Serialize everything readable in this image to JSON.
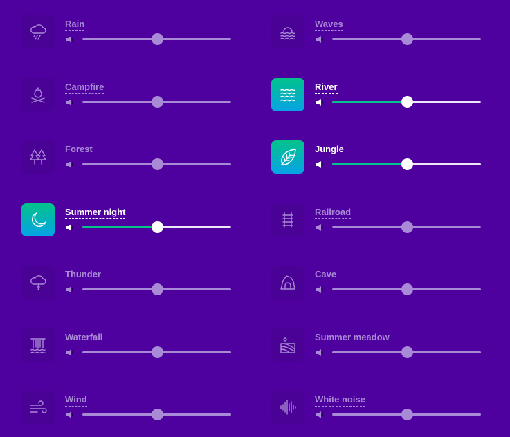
{
  "colors": {
    "background": "#4f019f",
    "inactive": "#a98ad6",
    "active_fill": "#01c38a",
    "gradient_top": "#01c38a",
    "gradient_bottom": "#06a3e6"
  },
  "sounds": [
    {
      "label": "Rain",
      "icon": "cloud-rain-icon",
      "active": false,
      "volume": 0.5,
      "underline": true
    },
    {
      "label": "Waves",
      "icon": "waves-sun-icon",
      "active": false,
      "volume": 0.5,
      "underline": true
    },
    {
      "label": "Campfire",
      "icon": "campfire-icon",
      "active": false,
      "volume": 0.5,
      "underline": true
    },
    {
      "label": "River",
      "icon": "river-waves-icon",
      "active": true,
      "volume": 0.5,
      "underline": true
    },
    {
      "label": "Forest",
      "icon": "trees-icon",
      "active": false,
      "volume": 0.5,
      "underline": true
    },
    {
      "label": "Jungle",
      "icon": "leaf-icon",
      "active": true,
      "volume": 0.5,
      "underline": false
    },
    {
      "label": "Summer night",
      "icon": "moon-icon",
      "active": true,
      "volume": 0.5,
      "underline": true
    },
    {
      "label": "Railroad",
      "icon": "railroad-icon",
      "active": false,
      "volume": 0.5,
      "underline": true
    },
    {
      "label": "Thunder",
      "icon": "cloud-lightning-icon",
      "active": false,
      "volume": 0.5,
      "underline": true
    },
    {
      "label": "Cave",
      "icon": "cave-icon",
      "active": false,
      "volume": 0.5,
      "underline": true
    },
    {
      "label": "Waterfall",
      "icon": "waterfall-icon",
      "active": false,
      "volume": 0.5,
      "underline": true
    },
    {
      "label": "Summer meadow",
      "icon": "meadow-icon",
      "active": false,
      "volume": 0.5,
      "underline": true
    },
    {
      "label": "Wind",
      "icon": "wind-icon",
      "active": false,
      "volume": 0.5,
      "underline": true
    },
    {
      "label": "White noise",
      "icon": "sound-wave-icon",
      "active": false,
      "volume": 0.5,
      "underline": true
    }
  ]
}
